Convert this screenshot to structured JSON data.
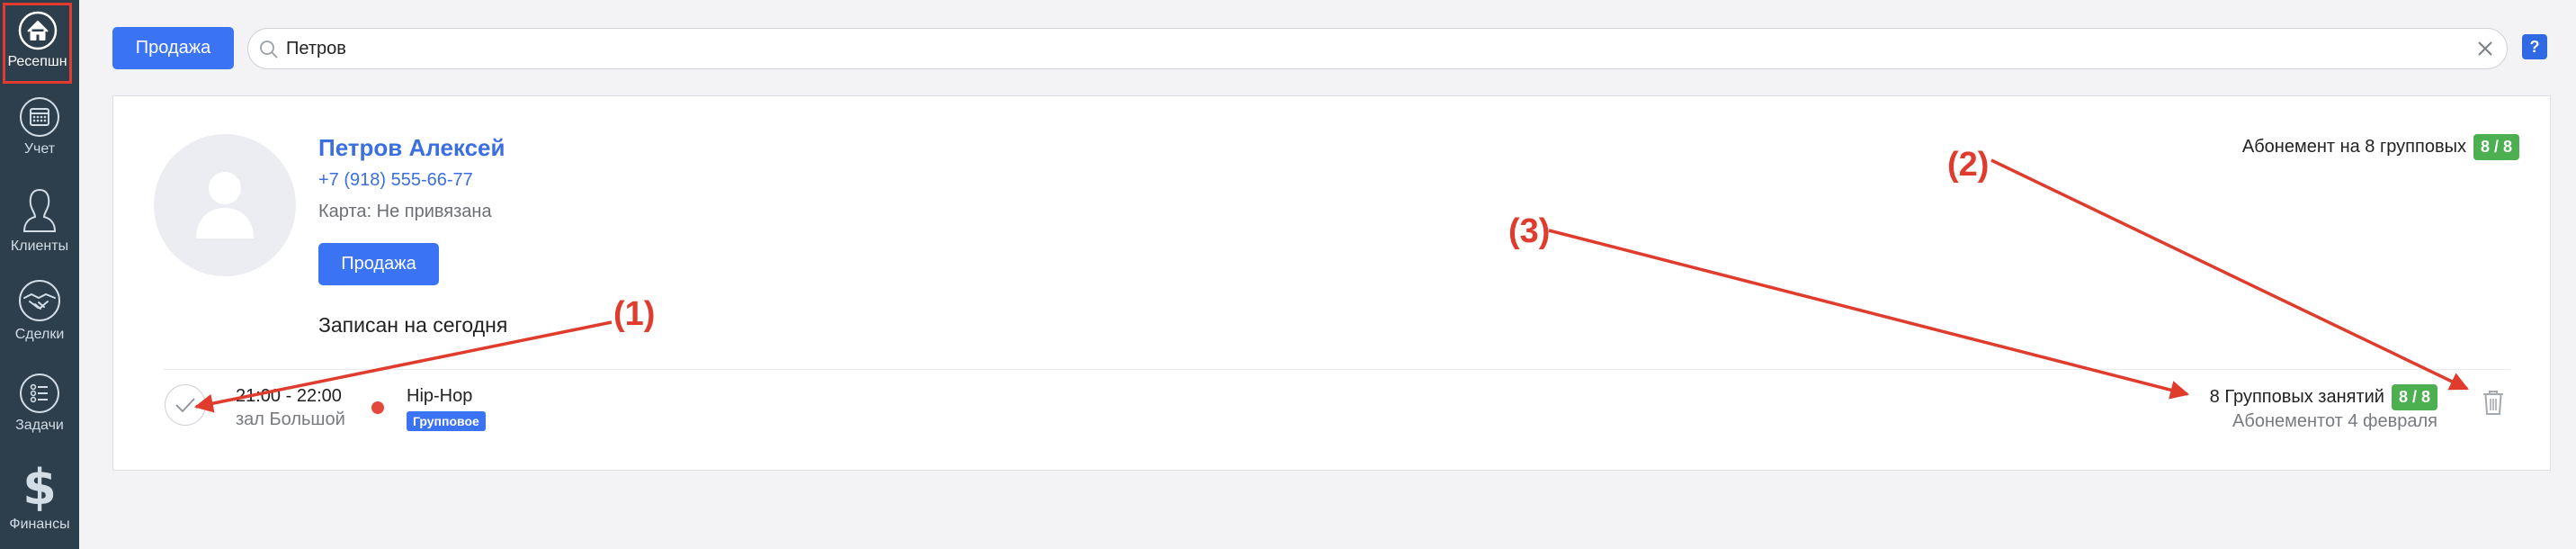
{
  "sidebar": {
    "items": [
      {
        "label": "Ресепшн",
        "icon": "house-icon",
        "active": true
      },
      {
        "label": "Учет",
        "icon": "calendar-icon"
      },
      {
        "label": "Клиенты",
        "icon": "person-icon"
      },
      {
        "label": "Сделки",
        "icon": "handshake-icon"
      },
      {
        "label": "Задачи",
        "icon": "checklist-icon"
      },
      {
        "label": "Финансы",
        "icon": "dollar-icon"
      }
    ]
  },
  "topbar": {
    "sale_label": "Продажа",
    "search_value": "Петров",
    "help_label": "?"
  },
  "client": {
    "name": "Петров Алексей",
    "phone": "+7 (918) 555-66-77",
    "card": "Карта: Не привязана",
    "sale_label": "Продажа",
    "subscription_title": "Абонемент на 8 групповых",
    "subscription_badge": "8 / 8"
  },
  "schedule": {
    "title": "Записан на сегодня",
    "entry": {
      "time": "21:00 - 22:00",
      "hall": "зал Большой",
      "name": "Hip-Hop",
      "type": "Групповое",
      "subscription": "8 Групповых занятий",
      "subscription_badge": "8 / 8",
      "subscription_date": "Абонементот 4 февраля"
    }
  },
  "annotations": {
    "label_1": "(1)",
    "label_2": "(2)",
    "label_3": "(3)"
  },
  "colors": {
    "sidebar_bg": "#2d3e4c",
    "accent": "#3b73f5",
    "badge_green": "#4caf50",
    "annotation_red": "#e03c2d"
  }
}
